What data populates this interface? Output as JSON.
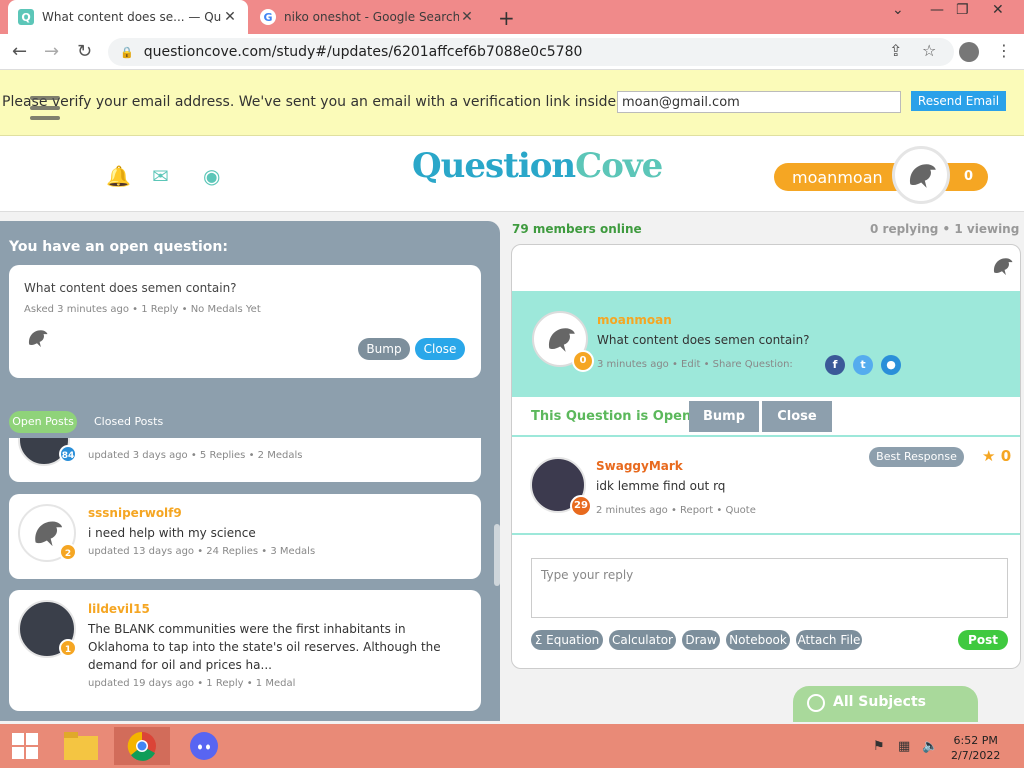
{
  "browser": {
    "tabs": [
      {
        "title": "What content does se... — Quest",
        "icon": "questioncove-favicon"
      },
      {
        "title": "niko oneshot - Google Search",
        "icon": "google-favicon"
      }
    ],
    "url": "questioncove.com/study#/updates/6201affcef6b7088e0c5780"
  },
  "verify": {
    "message": "Please verify your email address. We've sent you an email with a verification link inside.",
    "email_value": "moan@gmail.com",
    "resend_label": "Resend Email"
  },
  "header": {
    "logo_part1": "Question",
    "logo_part2": "Cove",
    "username": "moanmoan",
    "score": "0"
  },
  "left": {
    "title": "You have an open question:",
    "open_question": {
      "text": "What content does semen contain?",
      "meta": "Asked 3 minutes ago  •  1 Reply  •  No Medals Yet",
      "bump": "Bump",
      "close": "Close"
    },
    "tabs": {
      "open": "Open Posts",
      "closed": "Closed Posts"
    },
    "posts": [
      {
        "name": "",
        "text": "",
        "meta": "updated 3 days ago  •  5 Replies  •  2 Medals",
        "badge": "84"
      },
      {
        "name": "sssniperwolf9",
        "text": "i need help with my science",
        "meta": "updated 13 days ago  •  24 Replies  •  3 Medals",
        "badge": "2"
      },
      {
        "name": "lildevil15",
        "text": "The BLANK communities were the first inhabitants in Oklahoma to tap into the state's oil reserves. Although the demand for oil and prices ha...",
        "meta": "updated 19 days ago  •  1 Reply  •  1 Medal",
        "badge": "1"
      }
    ]
  },
  "right": {
    "online": "79 members online",
    "activity": "0 replying  •  1 viewing",
    "question": {
      "name": "moanmoan",
      "text": "What content does semen contain?",
      "meta": "3 minutes ago  •  Edit  •  Share Question:",
      "badge": "0"
    },
    "status": "This Question is Open",
    "bump": "Bump",
    "close": "Close",
    "reply": {
      "name": "SwaggyMark",
      "text": "idk lemme find out rq",
      "meta": "2 minutes ago  •  Report  •  Quote",
      "badge": "29",
      "best_response": "Best Response",
      "medals": "0"
    },
    "reply_placeholder": "Type your reply",
    "tools": [
      "Σ Equation",
      "Calculator",
      "Draw",
      "Notebook",
      "Attach File"
    ],
    "post_label": "Post",
    "all_subjects": "All Subjects"
  },
  "taskbar": {
    "time": "6:52 PM",
    "date": "2/7/2022"
  },
  "colors": {
    "accent_teal": "#5cc6b8",
    "accent_orange": "#f5a623",
    "banner_yellow": "#fbfbb9",
    "panel_gray": "#8d9fad"
  }
}
